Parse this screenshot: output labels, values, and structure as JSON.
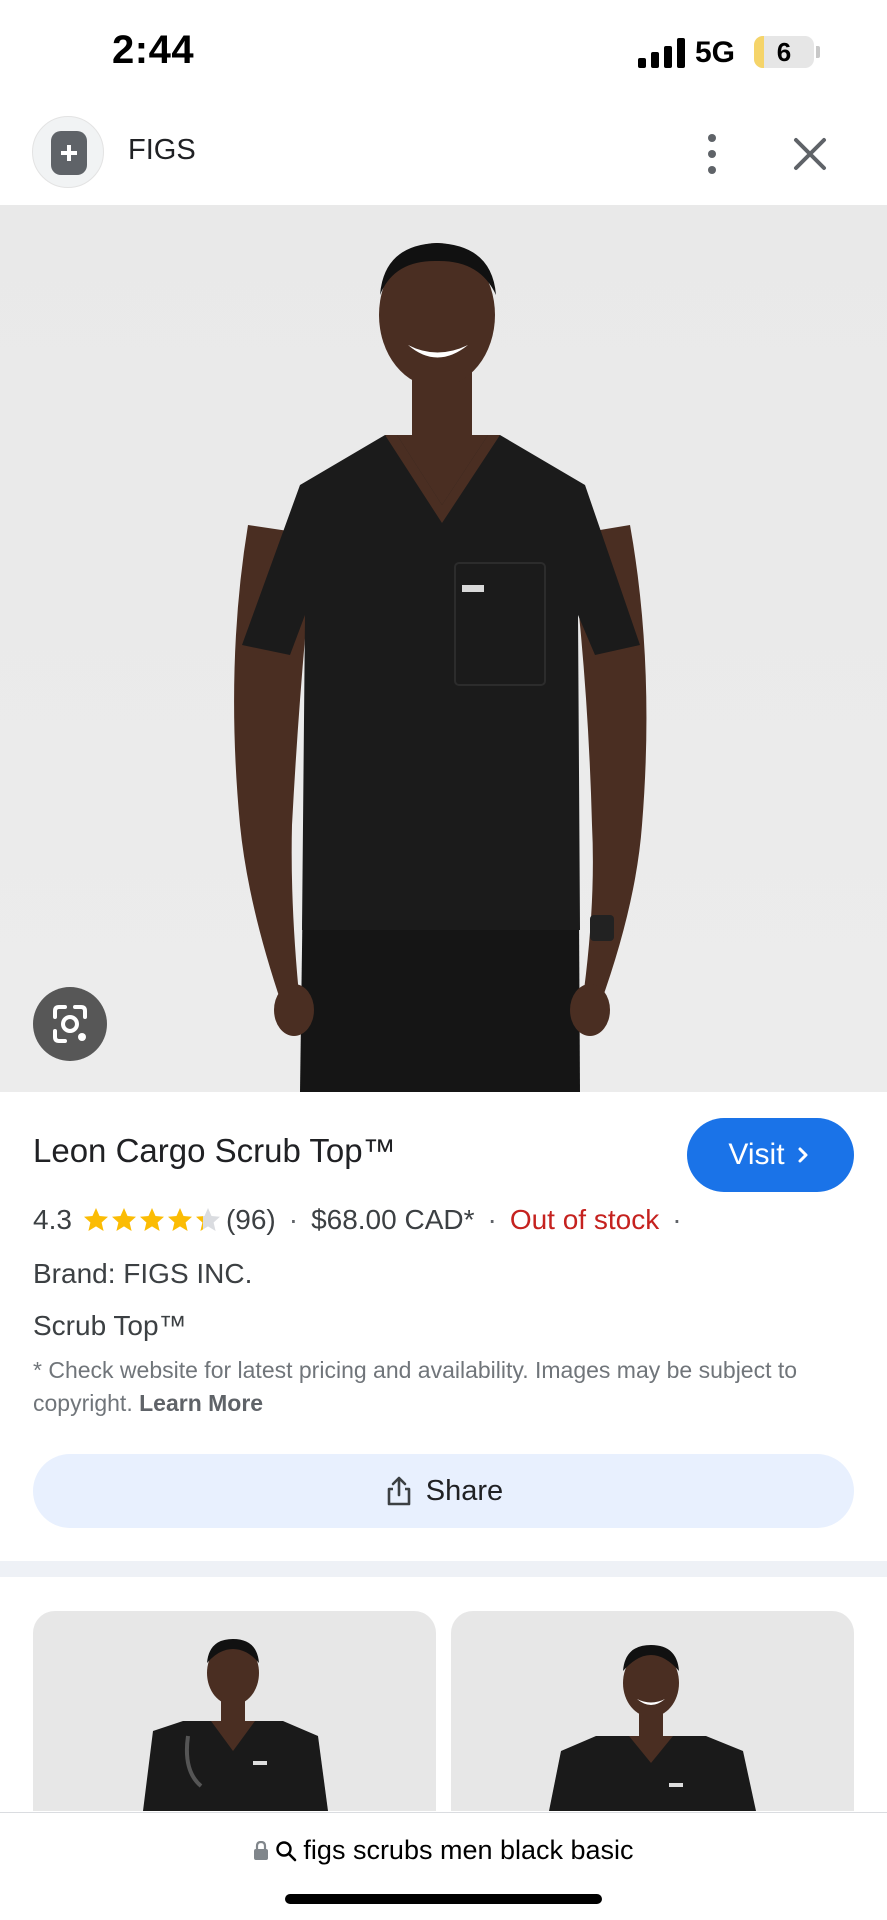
{
  "status_bar": {
    "time": "2:44",
    "network": "5G",
    "battery_level": "6"
  },
  "header": {
    "site_name": "FIGS"
  },
  "product": {
    "title": "Leon Cargo Scrub Top™",
    "visit_label": "Visit",
    "rating": "4.3",
    "rating_stars": 4.3,
    "reviews": "(96)",
    "price": "$68.00 CAD*",
    "stock": "Out of stock",
    "trailing_sep": "·",
    "brand": "Brand: FIGS INC.",
    "category": "Scrub Top™",
    "disclaimer": "* Check website for latest pricing and availability. Images may be subject to copyright.",
    "learn_more": "Learn More",
    "share_label": "Share"
  },
  "url_bar": {
    "url": "figs scrubs men black basic"
  },
  "colors": {
    "accent": "#1a73e8",
    "out_of_stock": "#c5221f",
    "star": "#fbbc04"
  },
  "icons": [
    "site-icon",
    "more-vert-icon",
    "close-icon",
    "lens-icon",
    "chevron-right-icon",
    "star-icon",
    "share-icon",
    "lock-icon",
    "search-icon"
  ]
}
